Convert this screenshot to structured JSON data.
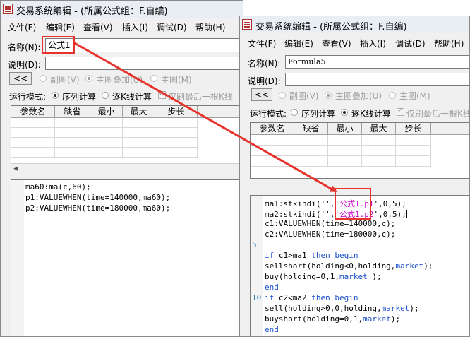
{
  "back_window": {
    "title": "交易系统编辑 - (所属公式组：F.自编)",
    "menu": [
      "文件(F)",
      "编辑(E)",
      "查看(V)",
      "插入(I)",
      "调试(D)",
      "帮助(H)"
    ],
    "name_label": "名称(N):",
    "name_value": "公式1",
    "desc_label": "说明(D):",
    "collapse_button": "<<",
    "chart_options": [
      "副图(V)",
      "主图叠加(U)",
      "主图(M)"
    ],
    "run_mode_label": "运行模式:",
    "run_modes": [
      "序列计算",
      "逐K线计算"
    ],
    "last_bar_only": "仅刷最后一根K线",
    "param_columns": [
      "参数名",
      "缺省",
      "最小",
      "最大",
      "步长"
    ],
    "code_lines": [
      "ma60:ma(c,60);",
      "p1:VALUEWHEN(time=140000,ma60);",
      "p2:VALUEWHEN(time=180000,ma60);"
    ]
  },
  "front_window": {
    "title": "交易系统编辑 - (所属公式组：F.自编)",
    "menu": [
      "文件(F)",
      "编辑(E)",
      "查看(V)",
      "插入(I)",
      "调试(D)",
      "帮助(H)"
    ],
    "name_label": "名称(N):",
    "name_value": "Formula5",
    "desc_label": "说明(D):",
    "collapse_button": "<<",
    "chart_options": [
      "副图(V)",
      "主图叠加(U)",
      "主图(M)"
    ],
    "run_mode_label": "运行模式:",
    "run_modes": [
      "序列计算",
      "逐K线计算"
    ],
    "last_bar_only": "仅刷最后一根K线",
    "param_columns": [
      "参数名",
      "缺省",
      "最小",
      "最大",
      "步长"
    ],
    "line_numbers": [
      "5",
      "10"
    ],
    "code": {
      "l1": {
        "a": "ma1:stkindi('','",
        "b": "公式1.p1",
        "c": "',0,5);"
      },
      "l2": {
        "a": "ma2:stkindi('','",
        "b": "公式1.p2",
        "c": "',0,5);"
      },
      "l3": {
        "a": "c1:VALUEWHEN(time=140000,c);"
      },
      "l4": {
        "a": "c2:VALUEWHEN(time=180000,c);"
      },
      "l6": {
        "k1": "if",
        "a": " c1>ma1 ",
        "k2": "then begin"
      },
      "l7": {
        "a": "sellshort(holding<0,holding,",
        "k": "market",
        "b": ");"
      },
      "l8": {
        "a": "buy(holding=0,1,",
        "k": "market",
        "b": " );"
      },
      "l9": {
        "k": "end"
      },
      "l10": {
        "k1": "if",
        "a": " c2<ma2 ",
        "k2": "then begin"
      },
      "l11": {
        "a": "sell(holding>0,0,holding,",
        "k": "market",
        "b": ");"
      },
      "l12": {
        "a": "buyshort(holding=0,1,",
        "k": "market",
        "b": ");"
      },
      "l13": {
        "k": "end"
      }
    }
  },
  "annotation_color": "#e8322c"
}
